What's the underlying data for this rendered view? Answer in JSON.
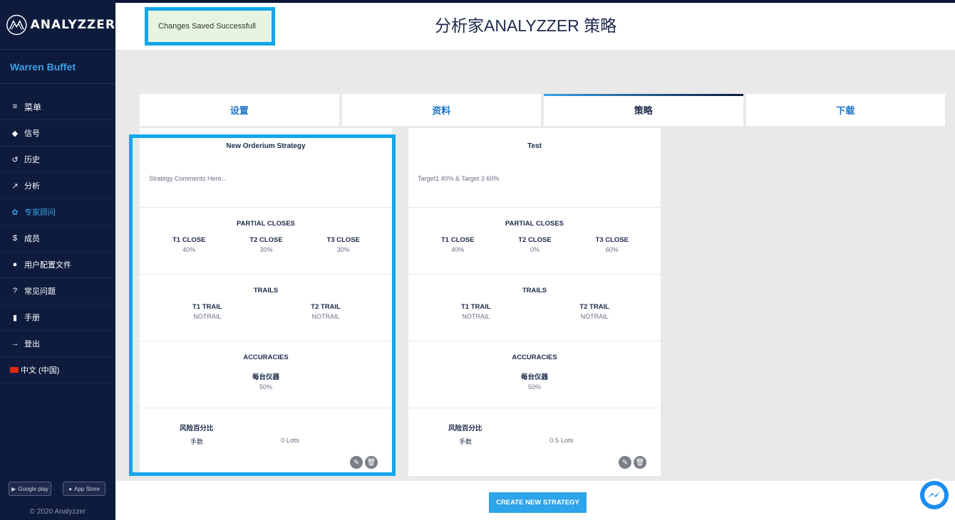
{
  "brand": {
    "name": "ANALYZZER"
  },
  "user": {
    "name": "Warren Buffet"
  },
  "sidebar": {
    "items": [
      {
        "icon": "≡",
        "label": "菜单"
      },
      {
        "icon": "◆",
        "label": "信号"
      },
      {
        "icon": "↺",
        "label": "历史"
      },
      {
        "icon": "↗",
        "label": "分析"
      },
      {
        "icon": "✿",
        "label": "专家顾问"
      },
      {
        "icon": "$",
        "label": "成员"
      },
      {
        "icon": "●",
        "label": "用户配置文件"
      },
      {
        "icon": "?",
        "label": "常见问题"
      },
      {
        "icon": "▮",
        "label": "手册"
      },
      {
        "icon": "→",
        "label": "登出"
      },
      {
        "icon": "",
        "label": "中文 (中国)"
      }
    ],
    "stores": [
      "Google play",
      "App Store"
    ],
    "copyright": "© 2020 Analyzzer"
  },
  "toast": {
    "message": "Changes Saved Successfull"
  },
  "header": {
    "title": "分析家ANALYZZER 策略"
  },
  "tabs": [
    "设置",
    "资料",
    "策略",
    "下载"
  ],
  "cards": [
    {
      "title": "New Orderium Strategy",
      "comment": "Strategy Comments Here...",
      "partial_closes": {
        "heading": "PARTIAL CLOSES",
        "items": [
          {
            "label": "T1 CLOSE",
            "value": "40%"
          },
          {
            "label": "T2 CLOSE",
            "value": "30%"
          },
          {
            "label": "T3 CLOSE",
            "value": "30%"
          }
        ]
      },
      "trails": {
        "heading": "TRAILS",
        "items": [
          {
            "label": "T1 TRAIL",
            "value": "NOTRAIL"
          },
          {
            "label": "T2 TRAIL",
            "value": "NOTRAIL"
          }
        ]
      },
      "accuracies": {
        "heading": "ACCURACIES",
        "label": "每台仪器",
        "value": "50%"
      },
      "risk": {
        "heading": "风险百分比",
        "label": "手数",
        "value": "0 Lots"
      }
    },
    {
      "title": "Test",
      "comment": "Target1 40% & Target 3 60%",
      "partial_closes": {
        "heading": "PARTIAL CLOSES",
        "items": [
          {
            "label": "T1 CLOSE",
            "value": "40%"
          },
          {
            "label": "T2 CLOSE",
            "value": "0%"
          },
          {
            "label": "T3 CLOSE",
            "value": "60%"
          }
        ]
      },
      "trails": {
        "heading": "TRAILS",
        "items": [
          {
            "label": "T1 TRAIL",
            "value": "NOTRAIL"
          },
          {
            "label": "T2 TRAIL",
            "value": "NOTRAIL"
          }
        ]
      },
      "accuracies": {
        "heading": "ACCURACIES",
        "label": "每台仪器",
        "value": "50%"
      },
      "risk": {
        "heading": "风险百分比",
        "label": "手数",
        "value": "0.5 Lots"
      }
    }
  ],
  "footer": {
    "create_button": "CREATE NEW STRATEGY"
  },
  "colors": {
    "sidebar_bg": "#0e1b3d",
    "accent": "#13a6ea",
    "active_menu": "#3aa0e6",
    "tab_text": "#1d74c8"
  },
  "active_tab_index": 2,
  "active_menu_index": 4
}
